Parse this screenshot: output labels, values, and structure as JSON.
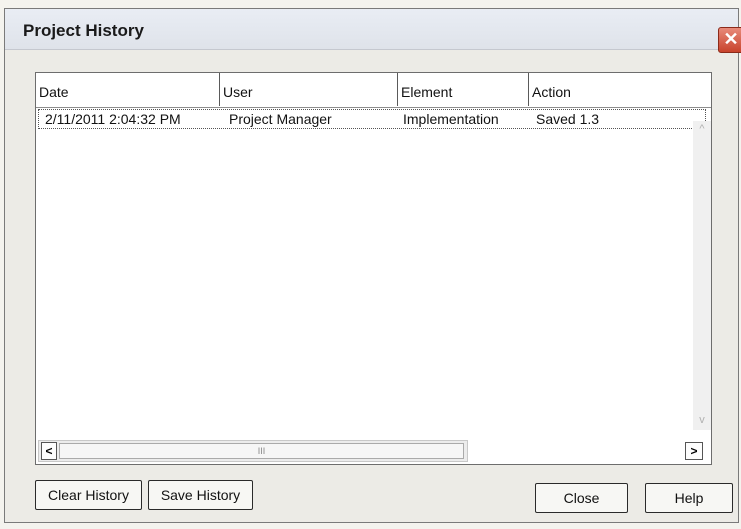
{
  "window": {
    "title": "Project History",
    "close_glyph": "✕"
  },
  "list": {
    "columns": [
      "Date",
      "User",
      "Element",
      "Action"
    ],
    "rows": [
      {
        "date": "2/11/2011 2:04:32 PM",
        "user": "Project Manager",
        "element": "Implementation",
        "action": "Saved 1.3"
      }
    ]
  },
  "scrollbar": {
    "left_glyph": "<",
    "right_glyph": ">",
    "thumb_grip": "III",
    "up_glyph": "^",
    "down_glyph": "v"
  },
  "buttons": {
    "clear_history": "Clear History",
    "save_history": "Save History",
    "close": "Close",
    "help": "Help"
  },
  "colors": {
    "close_button": "#c8432c",
    "dialog_bg": "#ecebe6"
  },
  "icons": {
    "close": "close-icon",
    "scroll_left": "chevron-left-icon",
    "scroll_right": "chevron-right-icon"
  }
}
